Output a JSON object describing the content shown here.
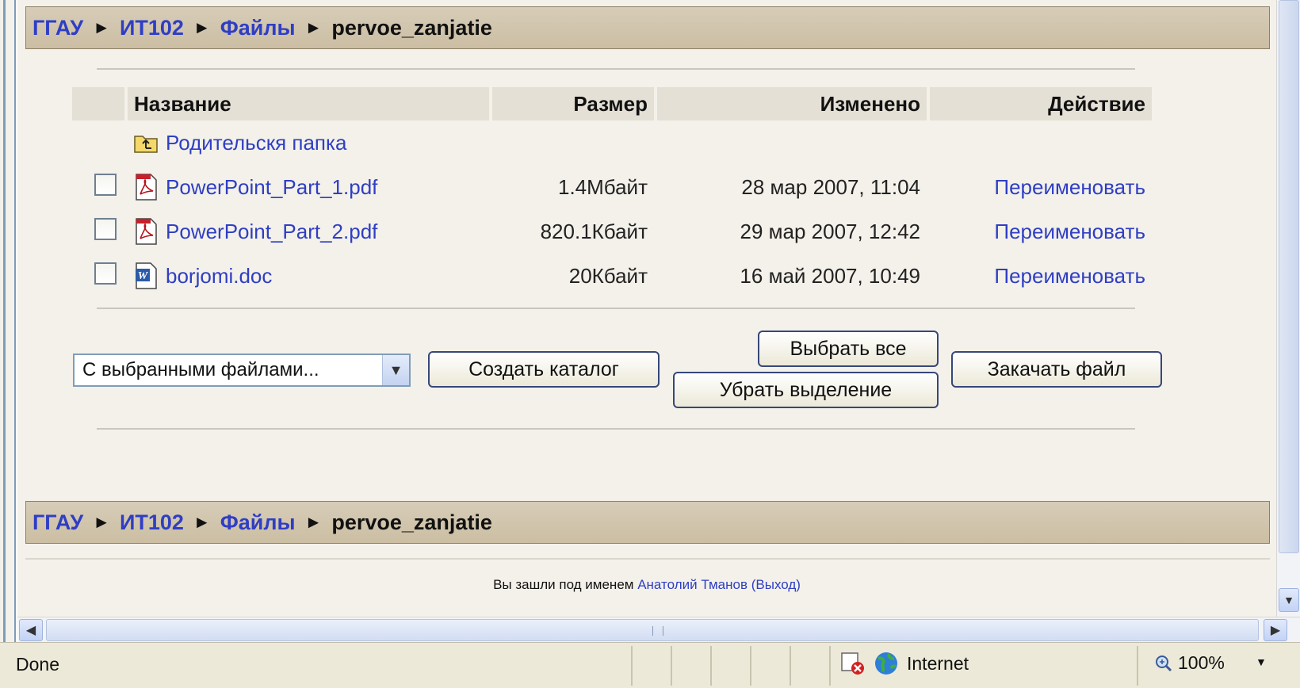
{
  "breadcrumb": {
    "items": [
      "ГГАУ",
      "ИТ102",
      "Файлы"
    ],
    "current": "pervoe_zanjatie",
    "separator": "►"
  },
  "table": {
    "headers": [
      "Название",
      "Размер",
      "Изменено",
      "Действие"
    ],
    "parent_folder": "Родительскя папка",
    "rows": [
      {
        "name": "PowerPoint_Part_1.pdf",
        "size": "1.4Мбайт",
        "modified": "28 мар 2007, 11:04",
        "action": "Переименовать",
        "icon": "pdf-file-icon"
      },
      {
        "name": "PowerPoint_Part_2.pdf",
        "size": "820.1Кбайт",
        "modified": "29 мар 2007, 12:42",
        "action": "Переименовать",
        "icon": "pdf-file-icon"
      },
      {
        "name": "borjomi.doc",
        "size": "20Кбайт",
        "modified": "16 май 2007, 10:49",
        "action": "Переименовать",
        "icon": "word-file-icon"
      }
    ]
  },
  "controls": {
    "select_value": "С выбранными файлами...",
    "create_dir": "Создать каталог",
    "select_all": "Выбрать все",
    "deselect": "Убрать выделение",
    "upload": "Закачать файл"
  },
  "footer": {
    "prefix": "Вы зашли под именем",
    "user": "Анатолий Тманов",
    "logout": "(Выход)"
  },
  "statusbar": {
    "status": "Done",
    "zone": "Internet",
    "zoom": "100%"
  },
  "colors": {
    "link": "#2f3ec4",
    "navbar": "#cbbea3",
    "page_bg": "#f3f1ea"
  }
}
